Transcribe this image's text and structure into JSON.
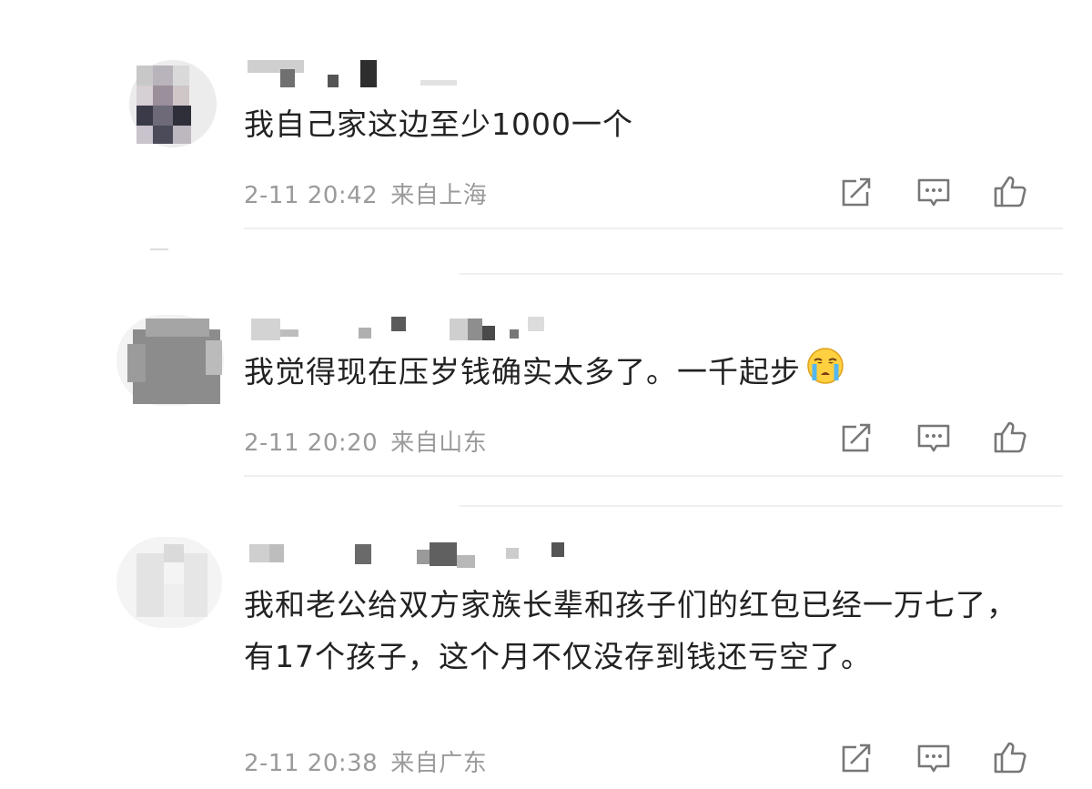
{
  "comments": [
    {
      "text": "我自己家这边至少1000一个",
      "time": "2-11 20:42",
      "location": "来自上海",
      "has_emoji": false
    },
    {
      "text": "我觉得现在压岁钱确实太多了。一千起步",
      "time": "2-11 20:20",
      "location": "来自山东",
      "has_emoji": true,
      "emoji": "crying-face"
    },
    {
      "text": "我和老公给双方家族长辈和孩子们的红包已经一万七了，有17个孩子，这个月不仅没存到钱还亏空了。",
      "time": "2-11 20:38",
      "location": "来自广东",
      "has_emoji": false
    }
  ],
  "actions": [
    "share-icon",
    "reply-icon",
    "like-icon"
  ],
  "colors": {
    "text": "#222222",
    "meta": "#9a9a9a",
    "icon": "#777777",
    "divider": "#efefef"
  }
}
